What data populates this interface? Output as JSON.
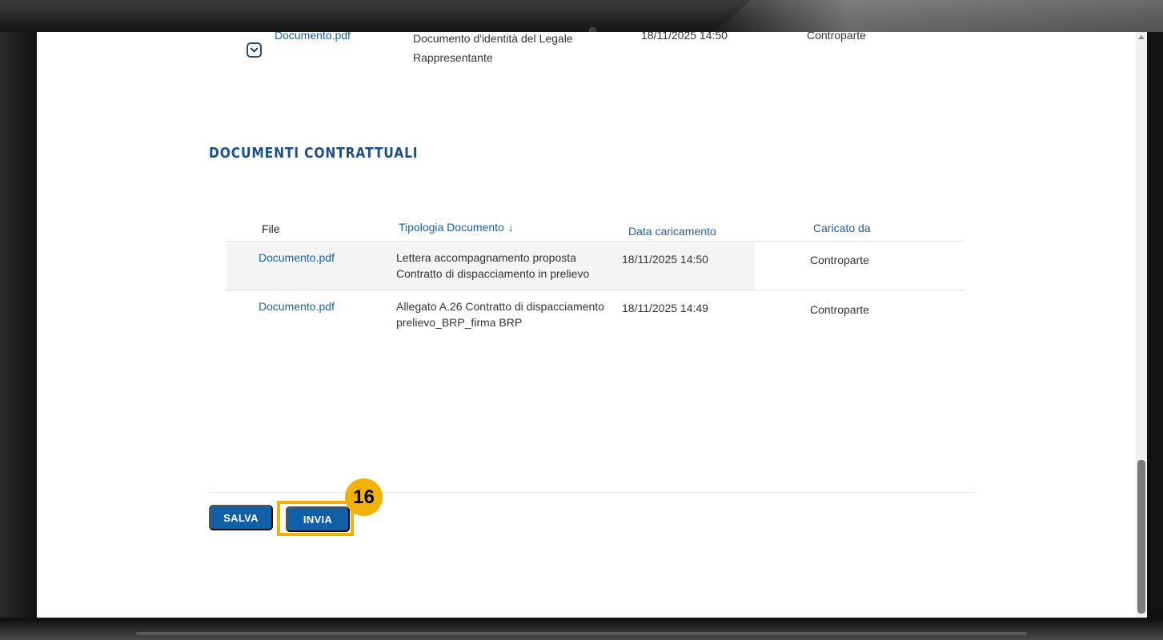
{
  "previous_row": {
    "file": "Documento.pdf",
    "type": "Documento d'identità del Legale Rappresentante",
    "date": "18/11/2025 14:50",
    "uploaded_by": "Controparte"
  },
  "section": {
    "title": "DOCUMENTI CONTRATTUALI"
  },
  "table": {
    "headers": {
      "file": "File",
      "type": "Tipologia Documento",
      "type_sort_arrow": "↓",
      "date": "Data caricamento",
      "uploaded_by": "Caricato da"
    },
    "rows": [
      {
        "file": "Documento.pdf",
        "type": "Lettera accompagnamento proposta Contratto di dispacciamento in prelievo",
        "date": "18/11/2025 14:50",
        "uploaded_by": "Controparte"
      },
      {
        "file": "Documento.pdf",
        "type": "Allegato A.26 Contratto di dispacciamento prelievo_BRP_firma BRP",
        "date": "18/11/2025 14:49",
        "uploaded_by": "Controparte"
      }
    ]
  },
  "actions": {
    "save_label": "SALVA",
    "send_label": "INVIA"
  },
  "annotation": {
    "step_number": "16",
    "color": "#f2b200"
  },
  "theme": {
    "primary": "#1060a8",
    "link": "#1a5faa",
    "title": "#1a4f8f"
  },
  "icons": {
    "expand": "chevron-down-icon",
    "sort": "arrow-down-icon",
    "scroll_up": "caret-up-icon"
  }
}
